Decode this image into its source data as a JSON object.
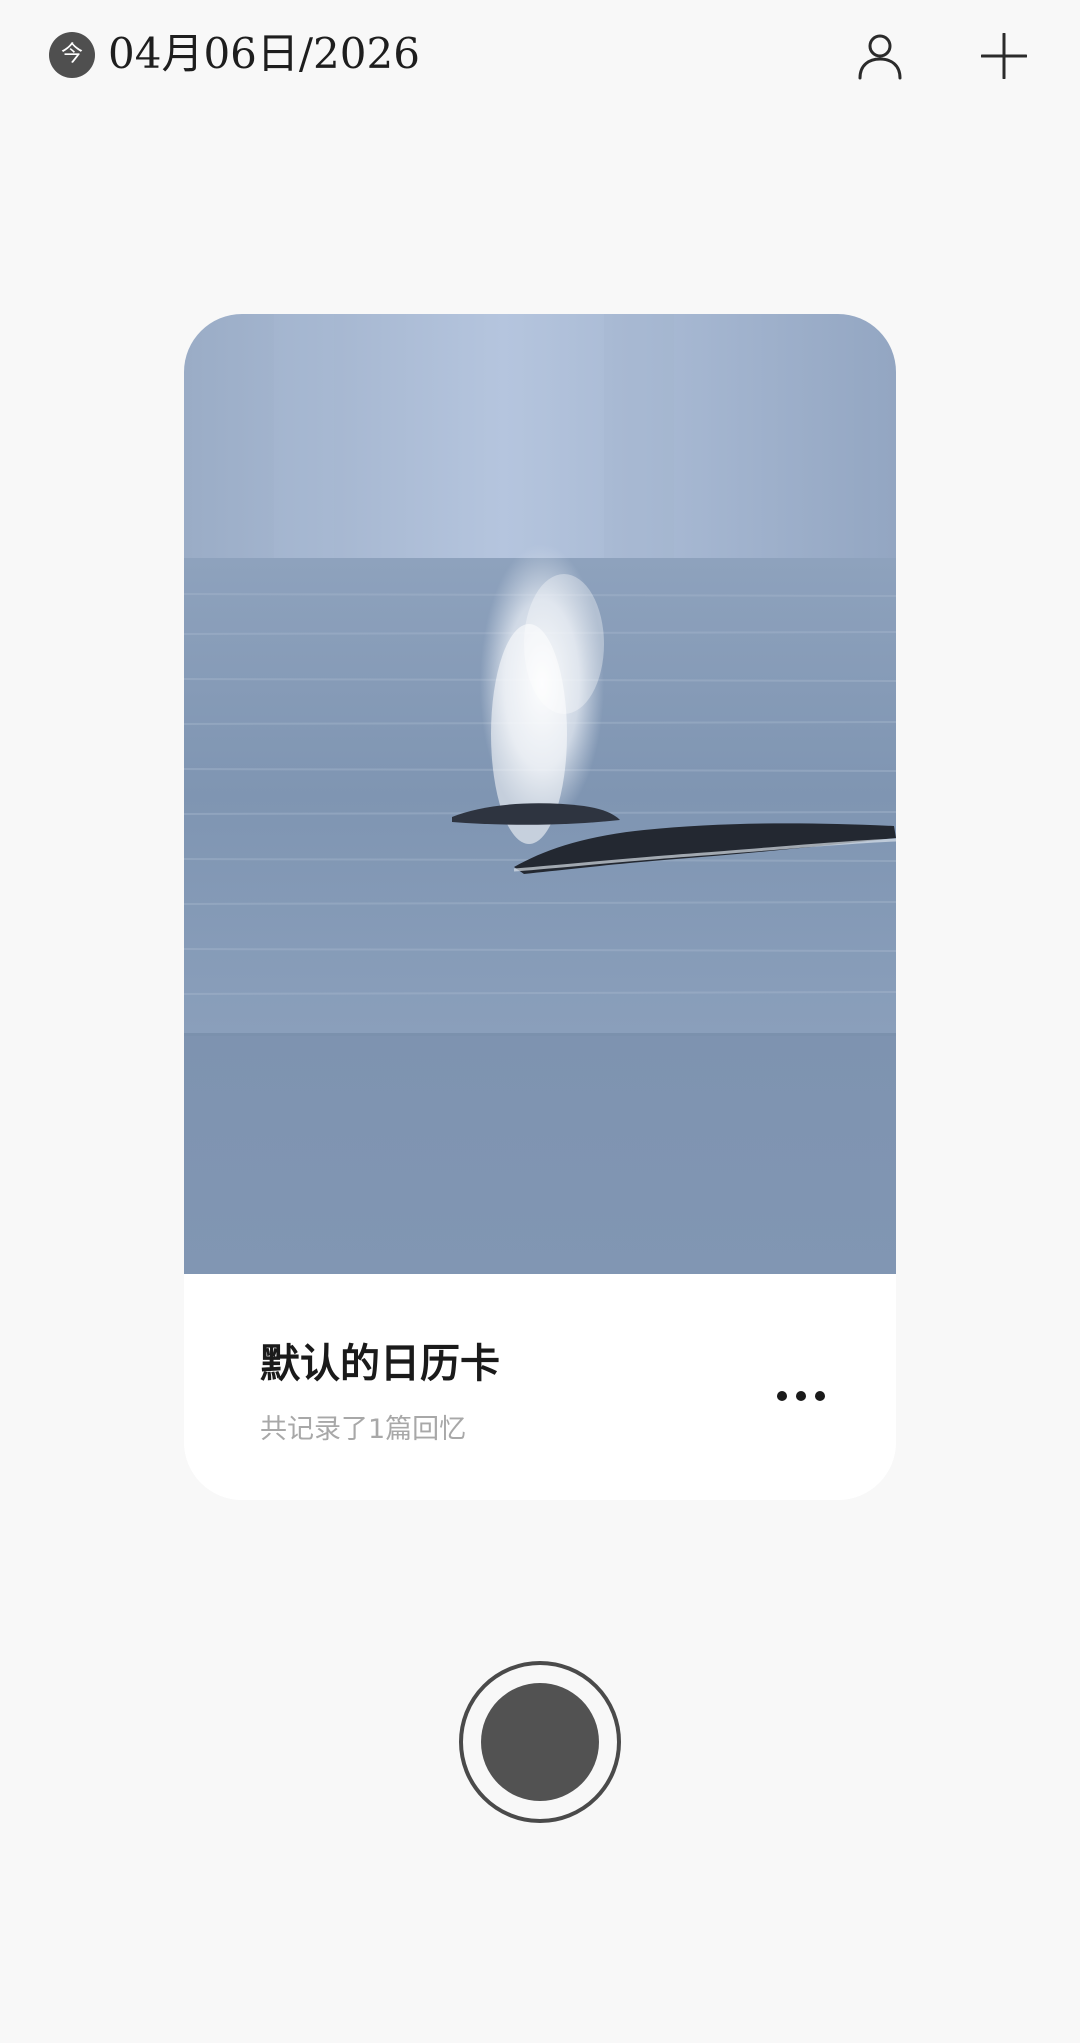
{
  "header": {
    "today_badge": "今",
    "date": "04月06日/2026",
    "user_icon": "user-icon",
    "add_icon": "plus-icon"
  },
  "card": {
    "title": "默认的日历卡",
    "subtitle": "共记录了1篇回忆",
    "photo": "whale-spouting-photo",
    "more_icon": "more-dots-icon"
  },
  "record": {
    "icon": "record-button-icon"
  },
  "colors": {
    "background": "#f8f8f8",
    "card_bg": "#ffffff",
    "dark_gray": "#4f4f4f",
    "subtitle_gray": "#a8a8a8"
  }
}
